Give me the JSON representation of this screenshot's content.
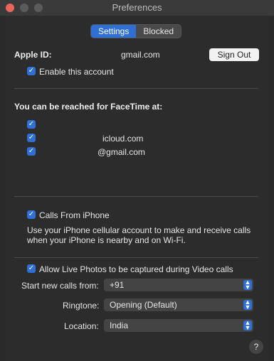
{
  "window": {
    "title": "Preferences"
  },
  "tabs": [
    {
      "label": "Settings",
      "active": true
    },
    {
      "label": "Blocked",
      "active": false
    }
  ],
  "account": {
    "apple_id_label": "Apple ID:",
    "apple_id_value": "gmail.com",
    "sign_out_label": "Sign Out",
    "enable_label": "Enable this account"
  },
  "reached": {
    "heading": "You can be reached for FaceTime at:",
    "items": [
      {
        "label": "",
        "checked": true
      },
      {
        "label": "icloud.com",
        "checked": true
      },
      {
        "label": "@gmail.com",
        "checked": true
      }
    ]
  },
  "calls_from_iphone": {
    "label": "Calls From iPhone",
    "desc_line1": "Use your iPhone cellular account to make and receive calls",
    "desc_line2": "when your iPhone is nearby and on Wi-Fi."
  },
  "live_photos": {
    "label": "Allow Live Photos to be captured during Video calls"
  },
  "fields": {
    "start_calls_label": "Start new calls from:",
    "start_calls_value": "+91",
    "ringtone_label": "Ringtone:",
    "ringtone_value": "Opening (Default)",
    "location_label": "Location:",
    "location_value": "India"
  },
  "help": {
    "label": "?"
  },
  "colors": {
    "accent": "#2f6fd6",
    "background": "#2c2c2c"
  },
  "icons": {
    "check": "checkmark-icon",
    "chevron": "up-down-chevron-icon"
  }
}
